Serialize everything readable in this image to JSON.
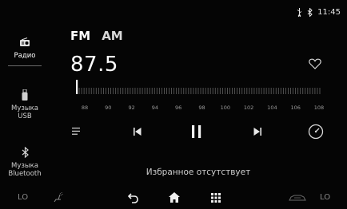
{
  "status": {
    "time": "11:45",
    "icons": [
      "usb-icon",
      "bluetooth-icon"
    ]
  },
  "sidebar": {
    "items": [
      {
        "label": "Радио",
        "icon": "radio-icon",
        "active": true
      },
      {
        "label": "Музыка\nUSB",
        "icon": "usb-stick-icon",
        "active": false
      },
      {
        "label": "Музыка\nBluetooth",
        "icon": "bluetooth-icon",
        "active": false
      }
    ]
  },
  "radio": {
    "bands": [
      "FM",
      "AM"
    ],
    "selected_band": "FM",
    "frequency": "87.5",
    "scale_labels": [
      "88",
      "90",
      "92",
      "94",
      "96",
      "98",
      "100",
      "102",
      "104",
      "106",
      "108"
    ],
    "empty_favorites": "Избранное отсутствует"
  },
  "bottom": {
    "left_temp": "LO",
    "right_temp": "LO"
  },
  "colors": {
    "background": "#050505",
    "text": "#ffffff",
    "dim": "#9a9a9a"
  }
}
